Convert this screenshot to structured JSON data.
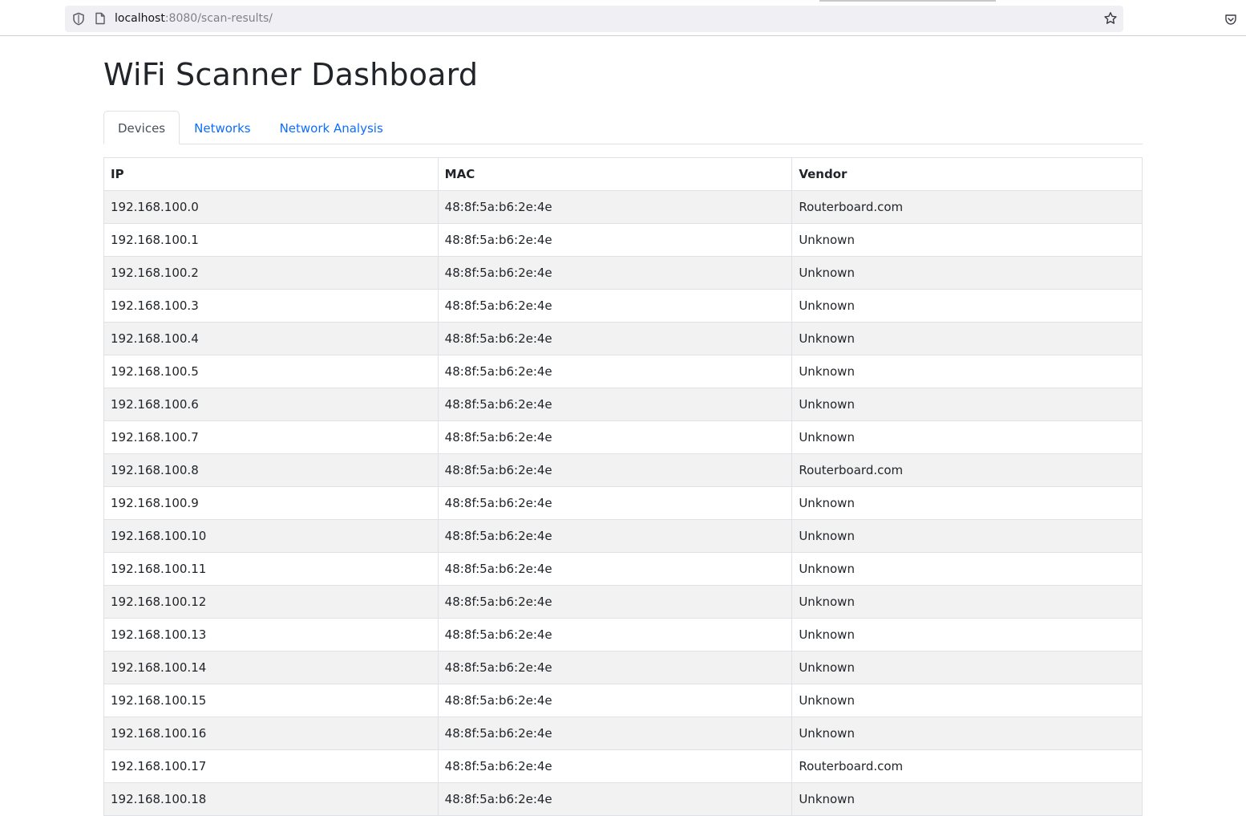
{
  "browser": {
    "url_host": "localhost",
    "url_rest": ":8080/scan-results/"
  },
  "page": {
    "title": "WiFi Scanner Dashboard"
  },
  "tabs": [
    {
      "label": "Devices",
      "active": true
    },
    {
      "label": "Networks",
      "active": false
    },
    {
      "label": "Network Analysis",
      "active": false
    }
  ],
  "table": {
    "headers": [
      "IP",
      "MAC",
      "Vendor"
    ],
    "rows": [
      [
        "192.168.100.0",
        "48:8f:5a:b6:2e:4e",
        "Routerboard.com"
      ],
      [
        "192.168.100.1",
        "48:8f:5a:b6:2e:4e",
        "Unknown"
      ],
      [
        "192.168.100.2",
        "48:8f:5a:b6:2e:4e",
        "Unknown"
      ],
      [
        "192.168.100.3",
        "48:8f:5a:b6:2e:4e",
        "Unknown"
      ],
      [
        "192.168.100.4",
        "48:8f:5a:b6:2e:4e",
        "Unknown"
      ],
      [
        "192.168.100.5",
        "48:8f:5a:b6:2e:4e",
        "Unknown"
      ],
      [
        "192.168.100.6",
        "48:8f:5a:b6:2e:4e",
        "Unknown"
      ],
      [
        "192.168.100.7",
        "48:8f:5a:b6:2e:4e",
        "Unknown"
      ],
      [
        "192.168.100.8",
        "48:8f:5a:b6:2e:4e",
        "Routerboard.com"
      ],
      [
        "192.168.100.9",
        "48:8f:5a:b6:2e:4e",
        "Unknown"
      ],
      [
        "192.168.100.10",
        "48:8f:5a:b6:2e:4e",
        "Unknown"
      ],
      [
        "192.168.100.11",
        "48:8f:5a:b6:2e:4e",
        "Unknown"
      ],
      [
        "192.168.100.12",
        "48:8f:5a:b6:2e:4e",
        "Unknown"
      ],
      [
        "192.168.100.13",
        "48:8f:5a:b6:2e:4e",
        "Unknown"
      ],
      [
        "192.168.100.14",
        "48:8f:5a:b6:2e:4e",
        "Unknown"
      ],
      [
        "192.168.100.15",
        "48:8f:5a:b6:2e:4e",
        "Unknown"
      ],
      [
        "192.168.100.16",
        "48:8f:5a:b6:2e:4e",
        "Unknown"
      ],
      [
        "192.168.100.17",
        "48:8f:5a:b6:2e:4e",
        "Routerboard.com"
      ],
      [
        "192.168.100.18",
        "48:8f:5a:b6:2e:4e",
        "Unknown"
      ]
    ]
  },
  "icons": {
    "shield": "shield-icon",
    "page": "page-icon",
    "star": "bookmark-star-icon",
    "pocket": "pocket-icon"
  },
  "colors": {
    "link": "#0d6efd",
    "stripe": "#f2f2f2",
    "border": "#dee2e6"
  }
}
